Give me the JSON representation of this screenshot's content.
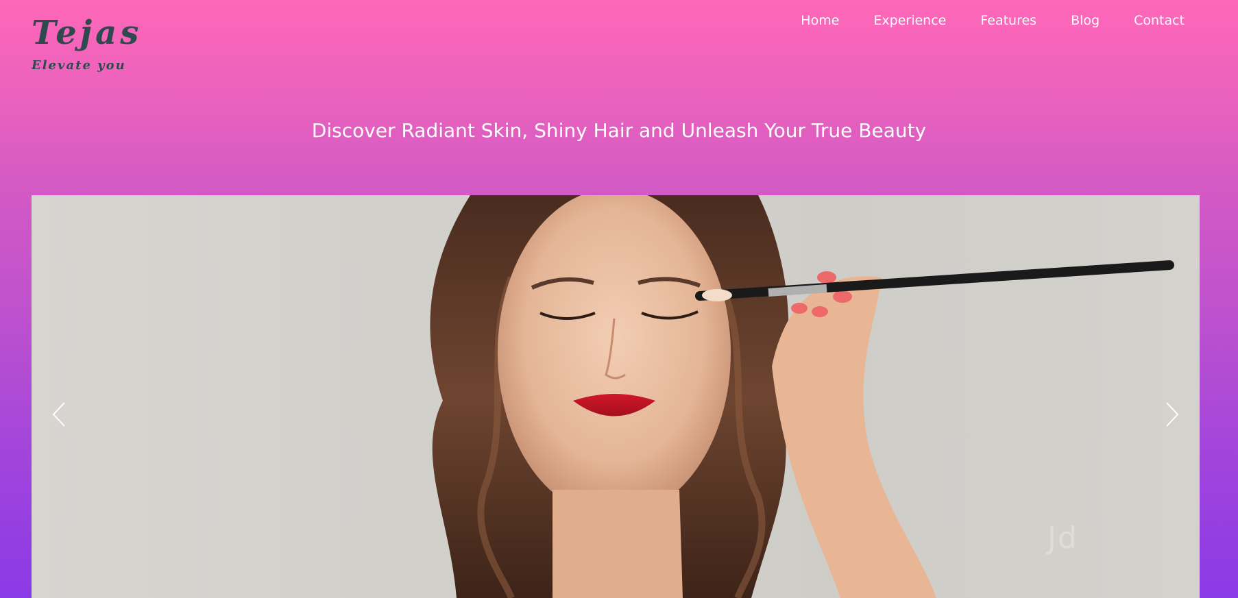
{
  "brand": {
    "name": "Tejas",
    "tagline": "Elevate you",
    "color": "#2f4a4e"
  },
  "nav": {
    "items": [
      {
        "label": "Home"
      },
      {
        "label": "Experience"
      },
      {
        "label": "Features"
      },
      {
        "label": "Blog"
      },
      {
        "label": "Contact"
      }
    ]
  },
  "hero": {
    "heading": "Discover Radiant Skin, Shiny Hair and Unleash Your True Beauty"
  },
  "carousel": {
    "prev_icon": "chevron-left-icon",
    "next_icon": "chevron-right-icon",
    "watermark": "Jd"
  },
  "colors": {
    "gradient_top": "#ff67b8",
    "gradient_bottom": "#8a3ae6",
    "text": "#ffffff"
  }
}
